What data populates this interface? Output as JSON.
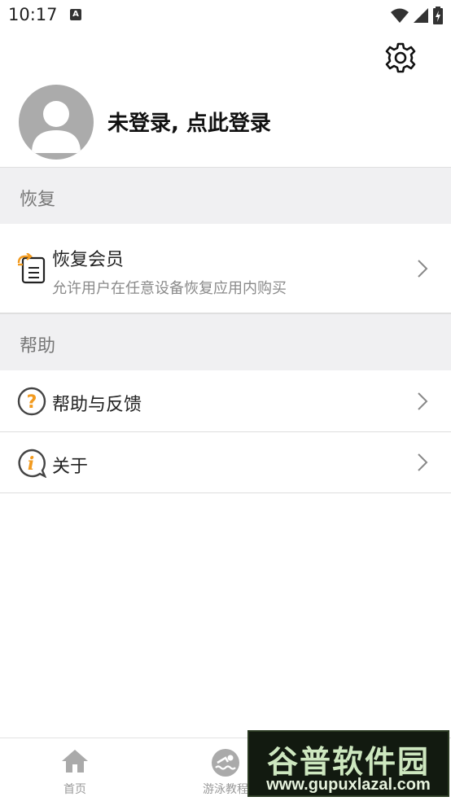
{
  "status_bar": {
    "time": "10:17",
    "notification_letter": "A"
  },
  "profile": {
    "login_prompt": "未登录, 点此登录"
  },
  "sections": [
    {
      "header": "恢复",
      "items": [
        {
          "title": "恢复会员",
          "subtitle": "允许用户在任意设备恢复应用内购买",
          "icon": "restore-document-icon"
        }
      ]
    },
    {
      "header": "帮助",
      "items": [
        {
          "title": "帮助与反馈",
          "icon": "question-circle-icon"
        },
        {
          "title": "关于",
          "icon": "info-bubble-icon"
        }
      ]
    }
  ],
  "bottom_nav": [
    {
      "label": "首页",
      "icon": "home-icon"
    },
    {
      "label": "游泳教程",
      "icon": "swimming-icon"
    }
  ],
  "watermark": {
    "title": "谷普软件园",
    "url": "www.gupuxlazal.com"
  },
  "colors": {
    "accent_orange": "#f29a1e",
    "section_bg": "#f0f0f2",
    "avatar_gray": "#ababab"
  }
}
